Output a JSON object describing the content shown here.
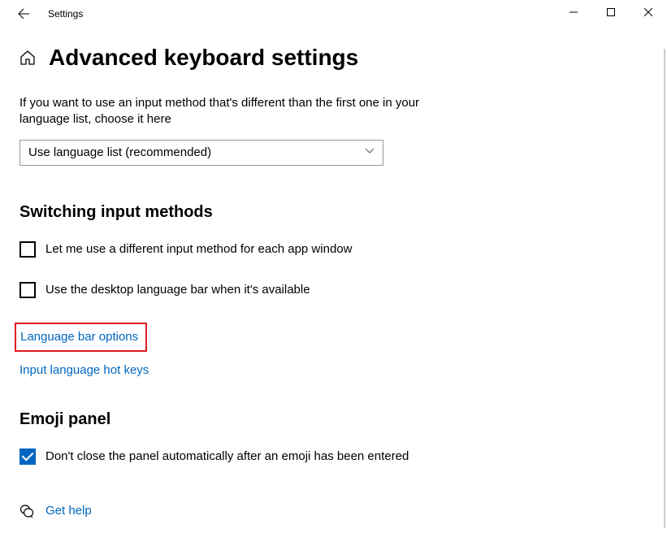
{
  "window": {
    "title": "Settings"
  },
  "page": {
    "title": "Advanced keyboard settings",
    "description": "If you want to use an input method that's different than the first one in your language list, choose it here"
  },
  "dropdown": {
    "value": "Use language list (recommended)"
  },
  "sections": {
    "switching": {
      "title": "Switching input methods",
      "checkbox1": "Let me use a different input method for each app window",
      "checkbox2": "Use the desktop language bar when it's available",
      "link1": "Language bar options",
      "link2": "Input language hot keys"
    },
    "emoji": {
      "title": "Emoji panel",
      "checkbox1": "Don't close the panel automatically after an emoji has been entered"
    }
  },
  "help": {
    "label": "Get help"
  }
}
